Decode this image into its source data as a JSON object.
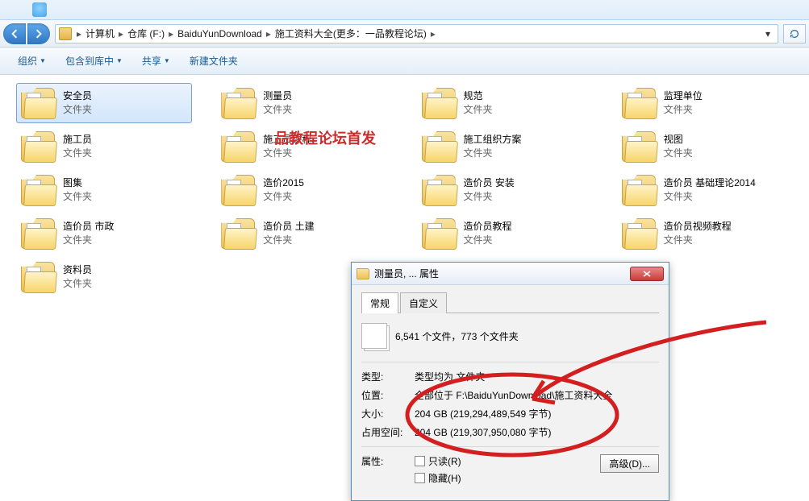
{
  "breadcrumb": {
    "items": [
      "计算机",
      "仓库 (F:)",
      "BaiduYunDownload",
      "施工资料大全(更多：一品教程论坛)"
    ]
  },
  "toolbar": {
    "organize": "组织",
    "include": "包含到库中",
    "share": "共享",
    "new_folder": "新建文件夹"
  },
  "watermark": "品教程论坛首发",
  "folders": [
    {
      "name": "安全员",
      "type": "文件夹",
      "selected": true
    },
    {
      "name": "测量员",
      "type": "文件夹"
    },
    {
      "name": "规范",
      "type": "文件夹"
    },
    {
      "name": "监理单位",
      "type": "文件夹"
    },
    {
      "name": "施工员",
      "type": "文件夹"
    },
    {
      "name": "施工员课程",
      "type": "文件夹"
    },
    {
      "name": "施工组织方案",
      "type": "文件夹"
    },
    {
      "name": "视图",
      "type": "文件夹"
    },
    {
      "name": "图集",
      "type": "文件夹"
    },
    {
      "name": "造价2015",
      "type": "文件夹"
    },
    {
      "name": "造价员 安装",
      "type": "文件夹"
    },
    {
      "name": "造价员 基础理论2014",
      "type": "文件夹"
    },
    {
      "name": "造价员 市政",
      "type": "文件夹"
    },
    {
      "name": "造价员 土建",
      "type": "文件夹"
    },
    {
      "name": "造价员教程",
      "type": "文件夹"
    },
    {
      "name": "造价员视频教程",
      "type": "文件夹"
    },
    {
      "name": "资料员",
      "type": "文件夹"
    }
  ],
  "dialog": {
    "title": "测量员, ... 属性",
    "tab_general": "常规",
    "tab_custom": "自定义",
    "file_count": "6,541 个文件，773 个文件夹",
    "rows": {
      "type_label": "类型:",
      "type_value": "类型均为 文件夹",
      "location_label": "位置:",
      "location_value": "全部位于 F:\\BaiduYunDownload\\施工资料大全",
      "size_label": "大小:",
      "size_value": "204 GB (219,294,489,549 字节)",
      "disk_label": "占用空间:",
      "disk_value": "204 GB (219,307,950,080 字节)"
    },
    "attrs_label": "属性:",
    "readonly": "只读(R)",
    "hidden": "隐藏(H)",
    "advanced": "高级(D)..."
  }
}
